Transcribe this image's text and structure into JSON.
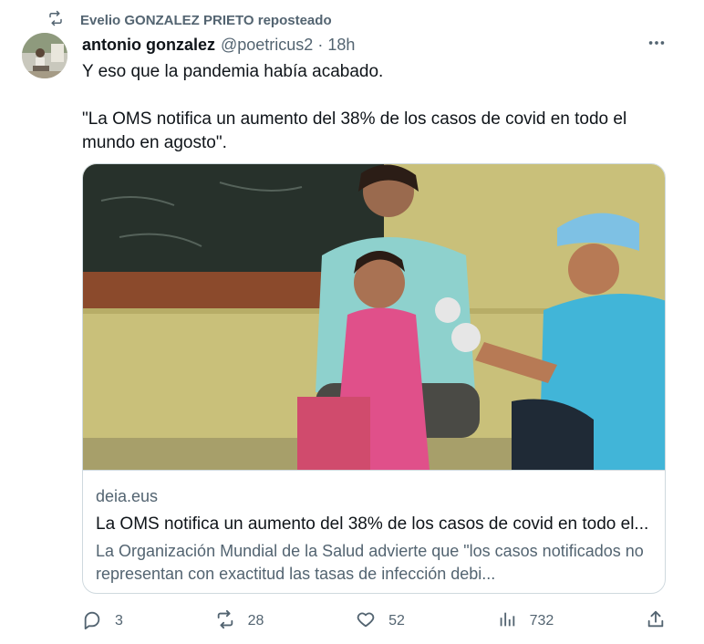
{
  "repost": {
    "text": "Evelio GONZALEZ PRIETO reposteado",
    "icon": "repost-icon"
  },
  "author": {
    "name": "antonio gonzalez",
    "handle": "@poetricus2",
    "separator": "·",
    "time": "18h"
  },
  "more_icon": "more-horizontal-icon",
  "text": {
    "paragraph1": "Y eso que la pandemia había acabado.",
    "paragraph2": "\"La OMS notifica un aumento del 38% de los casos de covid en todo el mundo en agosto\"."
  },
  "card": {
    "domain": "deia.eus",
    "title": "La OMS notifica un aumento del 38% de los casos de covid en todo el...",
    "description": "La Organización Mundial de la Salud advierte que \"los casos notificados no representan con exactitud las tasas de infección debi..."
  },
  "actions": {
    "replies": "3",
    "reposts": "28",
    "likes": "52",
    "views": "732"
  },
  "colors": {
    "text_primary": "#0f1419",
    "text_secondary": "#536471",
    "border": "#cfd9de"
  }
}
